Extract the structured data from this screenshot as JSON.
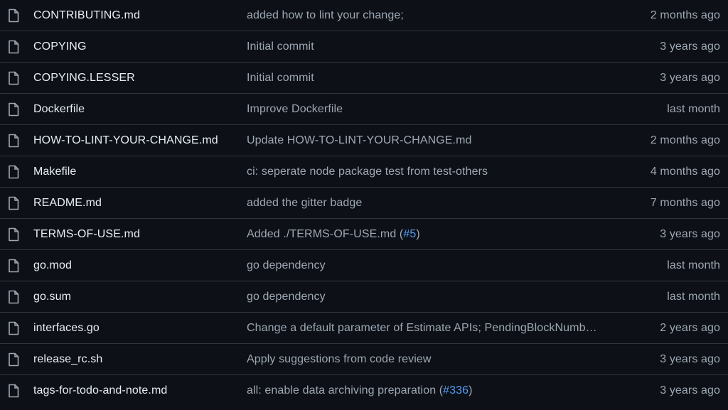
{
  "files": [
    {
      "name": "CONTRIBUTING.md",
      "message": "added how to lint your change;",
      "time": "2 months ago"
    },
    {
      "name": "COPYING",
      "message": "Initial commit",
      "time": "3 years ago"
    },
    {
      "name": "COPYING.LESSER",
      "message": "Initial commit",
      "time": "3 years ago"
    },
    {
      "name": "Dockerfile",
      "message": "Improve Dockerfile",
      "time": "last month"
    },
    {
      "name": "HOW-TO-LINT-YOUR-CHANGE.md",
      "message": "Update HOW-TO-LINT-YOUR-CHANGE.md",
      "time": "2 months ago"
    },
    {
      "name": "Makefile",
      "message": "ci: seperate node package test from test-others",
      "time": "4 months ago"
    },
    {
      "name": "README.md",
      "message": "added the gitter badge",
      "time": "7 months ago"
    },
    {
      "name": "TERMS-OF-USE.md",
      "message": "Added ./TERMS-OF-USE.md (",
      "message_link": "#5",
      "message_suffix": ")",
      "time": "3 years ago"
    },
    {
      "name": "go.mod",
      "message": "go dependency",
      "time": "last month"
    },
    {
      "name": "go.sum",
      "message": "go dependency",
      "time": "last month"
    },
    {
      "name": "interfaces.go",
      "message": "Change a default parameter of Estimate APIs; PendingBlockNumb…",
      "time": "2 years ago"
    },
    {
      "name": "release_rc.sh",
      "message": "Apply suggestions from code review",
      "time": "3 years ago"
    },
    {
      "name": "tags-for-todo-and-note.md",
      "message": "all: enable data archiving preparation (",
      "message_link": "#336",
      "message_suffix": ")",
      "time": "3 years ago"
    }
  ],
  "icons": {
    "file": "file-icon"
  },
  "colors": {
    "background": "#0d1117",
    "divider": "#30363d",
    "file_name": "#e6edf3",
    "muted_text": "#9ea7b3",
    "link": "#539bf5"
  }
}
